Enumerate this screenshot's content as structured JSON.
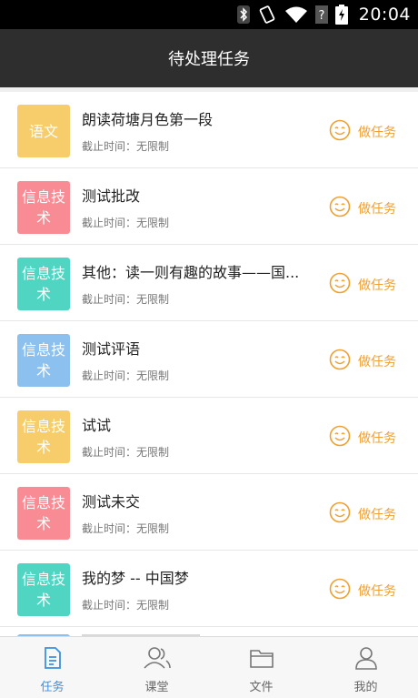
{
  "status_bar": {
    "time": "20:04"
  },
  "header": {
    "title": "待处理任务"
  },
  "colors": {
    "yellow": "#f7cd6c",
    "pink": "#f88b93",
    "teal": "#4fd5c2",
    "blue": "#8cc0ef",
    "accent": "#f0a030",
    "tab_active": "#3d8fe0"
  },
  "tasks": [
    {
      "subject": "语文",
      "color": "#f7cd6c",
      "title": "朗读荷塘月色第一段",
      "deadline": "截止时间：无限制",
      "action": "做任务"
    },
    {
      "subject": "信息技术",
      "color": "#f88b93",
      "title": "测试批改",
      "deadline": "截止时间：无限制",
      "action": "做任务"
    },
    {
      "subject": "信息技术",
      "color": "#4fd5c2",
      "title": "其他：读一则有趣的故事——国...",
      "deadline": "截止时间：无限制",
      "action": "做任务"
    },
    {
      "subject": "信息技术",
      "color": "#8cc0ef",
      "title": "测试评语",
      "deadline": "截止时间：无限制",
      "action": "做任务"
    },
    {
      "subject": "信息技术",
      "color": "#f7cd6c",
      "title": "试试",
      "deadline": "截止时间：无限制",
      "action": "做任务"
    },
    {
      "subject": "信息技术",
      "color": "#f88b93",
      "title": "测试未交",
      "deadline": "截止时间：无限制",
      "action": "做任务"
    },
    {
      "subject": "信息技术",
      "color": "#4fd5c2",
      "title": "我的梦 -- 中国梦",
      "deadline": "截止时间：无限制",
      "action": "做任务"
    }
  ],
  "tabs": [
    {
      "label": "任务",
      "icon": "task-icon",
      "active": true
    },
    {
      "label": "课堂",
      "icon": "classroom-icon",
      "active": false
    },
    {
      "label": "文件",
      "icon": "folder-icon",
      "active": false
    },
    {
      "label": "我的",
      "icon": "profile-icon",
      "active": false
    }
  ]
}
